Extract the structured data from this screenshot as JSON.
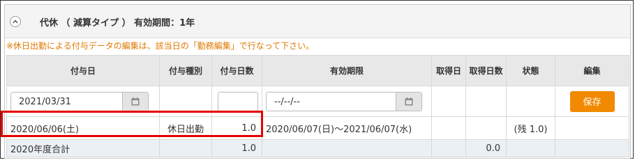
{
  "panel": {
    "title": "代休 （ 減算タイプ ） 有効期間：1年",
    "notice": "※休日出勤による付与データの編集は、該当日の「勤務編集」で行なって下さい。"
  },
  "table": {
    "headers": [
      "付与日",
      "付与種別",
      "付与日数",
      "有効期限",
      "取得日",
      "取得日数",
      "状態",
      "編集"
    ],
    "input_row": {
      "grant_date_value": "2021/03/31",
      "grant_days_value": "",
      "expiry_value": "--/--/--",
      "save_label": "保存"
    },
    "data_row": {
      "grant_date": "2020/06/06(土)",
      "grant_type": "休日出勤",
      "grant_days": "1.0",
      "expiry": "2020/06/07(日)～2021/06/07(水)",
      "taken_date": "",
      "taken_days": "",
      "status": "(残 1.0)",
      "edit": ""
    },
    "total_row": {
      "label": "2020年度合計",
      "grant_days": "1.0",
      "taken_days": "0.0"
    }
  },
  "icons": {
    "collapse": "chevron-up-icon",
    "calendar": "calendar-icon"
  },
  "colors": {
    "notice": "#e07800",
    "save_button": "#f18a00",
    "highlight": "#e60000",
    "header_bg": "#e8e8e8",
    "total_bg": "#ebf0f5"
  }
}
